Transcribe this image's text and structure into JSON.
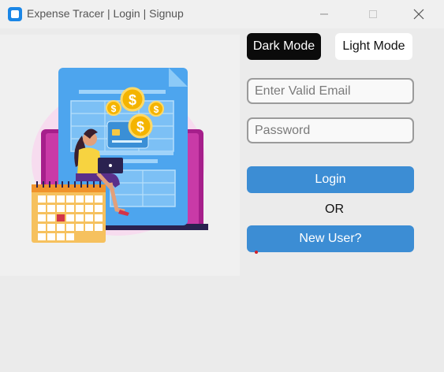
{
  "window": {
    "title": "Expense Tracer | Login | Signup",
    "icons": {
      "app": "app-icon",
      "minimize": "minimize-icon",
      "maximize": "maximize-icon",
      "close": "close-icon"
    }
  },
  "illustration": {
    "name": "expense-illustration",
    "dollar_symbol": "$"
  },
  "theme_toggle": {
    "dark_label": "Dark Mode",
    "light_label": "Light Mode"
  },
  "form": {
    "email_placeholder": "Enter Valid Email",
    "email_value": "",
    "password_placeholder": "Password",
    "password_value": "",
    "login_label": "Login",
    "or_label": "OR",
    "new_user_label": "New User?"
  },
  "colors": {
    "accent": "#3c8dd4",
    "dark_button": "#0b0b0b",
    "light_button": "#ffffff",
    "background": "#ebebeb"
  }
}
